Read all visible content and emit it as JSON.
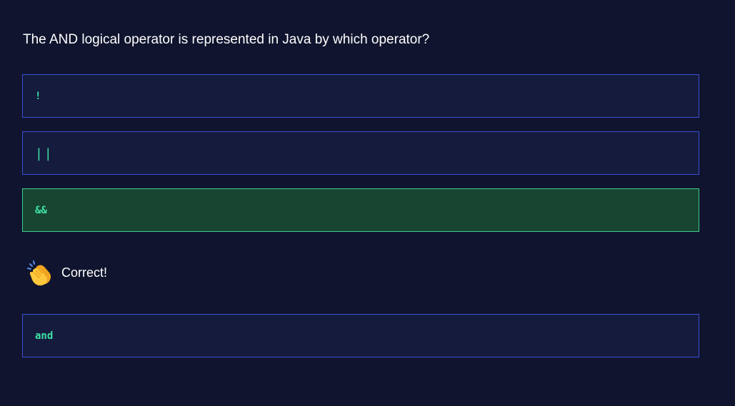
{
  "question": "The AND logical operator is represented in Java by which operator?",
  "options": [
    {
      "label": "!",
      "state": "default"
    },
    {
      "label": "||",
      "state": "default"
    },
    {
      "label": "&&",
      "state": "correct"
    },
    {
      "label": "and",
      "state": "default"
    }
  ],
  "feedback": {
    "icon": "clapping-hands-icon",
    "text": "Correct!"
  },
  "colors": {
    "background": "#10142e",
    "option_border": "#3a4fd6",
    "option_fill": "#151b3d",
    "correct_border": "#3fcf8e",
    "correct_fill": "#184532",
    "code_text": "#3fe0a6"
  }
}
